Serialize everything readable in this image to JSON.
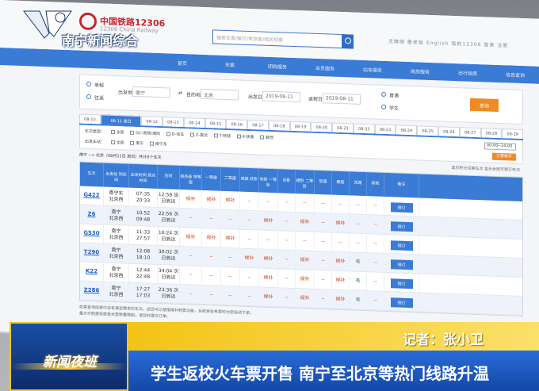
{
  "overlay": {
    "channel_name": "南宁新闻综合",
    "program_title": "新闻夜班",
    "reporter": "记者：张小卫",
    "headline": "学生返校火车票开售 南宁至北京等热门线路升温"
  },
  "site": {
    "name": "中国铁路12306",
    "subtitle": "12306 China Railway",
    "search_placeholder": "搜索车票/餐饮/常旅客/相关规章",
    "top_links": "无障碍  敬老版  English  我的12306  登录  注册"
  },
  "nav": [
    "首页",
    "车票",
    "团购服务",
    "会员服务",
    "站车服务",
    "商旅服务",
    "出行指南",
    "信息查询"
  ],
  "query": {
    "type_single": "单程",
    "type_return": "往返",
    "from_label": "出发地",
    "from_value": "南宁",
    "to_label": "目的地",
    "to_value": "北京",
    "date_label": "出发日",
    "date_value": "2019-08-11",
    "return_label": "返程日",
    "return_value": "2019-08-11",
    "passenger_normal": "普通",
    "passenger_student": "学生",
    "query_button": "查询"
  },
  "date_tabs": [
    "08-10",
    "08-11 周日",
    "08-12",
    "08-13",
    "08-14",
    "08-15",
    "08-16",
    "08-17",
    "08-18",
    "08-19",
    "08-20",
    "08-21",
    "08-22",
    "08-23",
    "08-24",
    "08-25",
    "08-26",
    "08-27",
    "08-28",
    "08-29"
  ],
  "filters": {
    "type_label": "车次类型：",
    "types": [
      "全部",
      "GC-高铁/城际",
      "D-动车",
      "Z-直达",
      "T-特快",
      "K-快速",
      "其他"
    ],
    "station_label": "出发车站：",
    "stations": [
      "全部",
      "南宁",
      "南宁东"
    ],
    "time_label": "发车时间：",
    "time_value": "00:00--24:00",
    "filter_button": "订票助手"
  },
  "route_bar": {
    "left": "南宁 --> 北京（08月11日 周日）共计6个车次",
    "right": "显示积分兑换车次  显示全部可预订车次"
  },
  "table": {
    "headers": [
      "车次",
      "出发站 到达站",
      "出发时间 到达时间",
      "历时",
      "商务座 特等座",
      "一等座",
      "二等座",
      "高级 软卧",
      "软卧 一等卧",
      "动卧",
      "硬卧 二等卧",
      "软座",
      "硬座",
      "无座",
      "其他",
      "备注"
    ],
    "rows": [
      {
        "train": "G422",
        "from": "南宁东",
        "to": "北京西",
        "dep": "07:35",
        "arr": "20:33",
        "dur": "12:58 当日到达",
        "seats": [
          "候补",
          "候补",
          "候补",
          "--",
          "--",
          "--",
          "--",
          "--",
          "--",
          "--",
          "--"
        ],
        "action": "预订"
      },
      {
        "train": "Z6",
        "from": "南宁",
        "to": "北京西",
        "dep": "10:52",
        "arr": "09:48",
        "dur": "22:56 次日到达",
        "seats": [
          "--",
          "--",
          "--",
          "--",
          "候补",
          "--",
          "候补",
          "--",
          "候补",
          "--",
          "--"
        ],
        "action": "预订"
      },
      {
        "train": "G530",
        "from": "南宁",
        "to": "北京西",
        "dep": "11:33",
        "arr": "27:57",
        "dur": "16:24 次日到达",
        "seats": [
          "候补",
          "候补",
          "候补",
          "--",
          "--",
          "--",
          "--",
          "--",
          "--",
          "--",
          "--"
        ],
        "action": "预订"
      },
      {
        "train": "T290",
        "from": "南宁",
        "to": "北京西",
        "dep": "12:08",
        "arr": "18:10",
        "dur": "30:02 次日到达",
        "seats": [
          "--",
          "--",
          "--",
          "候补",
          "候补",
          "--",
          "候补",
          "--",
          "候补",
          "有",
          "--"
        ],
        "action": "预订"
      },
      {
        "train": "K22",
        "from": "南宁",
        "to": "北京西",
        "dep": "12:44",
        "arr": "22:48",
        "dur": "34:04 次日到达",
        "seats": [
          "--",
          "--",
          "--",
          "--",
          "候补",
          "--",
          "候补",
          "--",
          "候补",
          "有",
          "--"
        ],
        "action": "预订"
      },
      {
        "train": "Z286",
        "from": "南宁",
        "to": "北京西",
        "dep": "17:27",
        "arr": "17:03",
        "dur": "23:36 次日到达",
        "seats": [
          "--",
          "--",
          "--",
          "--",
          "候补",
          "--",
          "候补",
          "--",
          "候补",
          "有",
          "--"
        ],
        "action": "预订"
      }
    ]
  },
  "notes": [
    "如果查询结果中没有满足需求的车次，您还可以使用候补购票功能，系统将在有票时为您自动下单。",
    "最大可购票张数受余票数量限制，请及时提交订单。"
  ]
}
